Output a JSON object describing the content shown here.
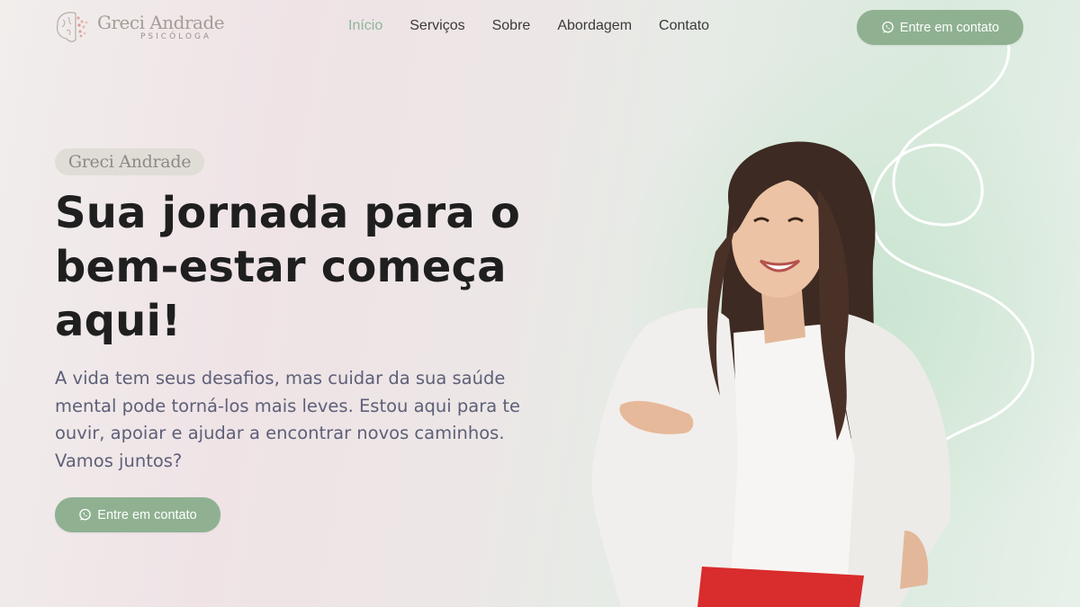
{
  "brand": {
    "name": "Greci Andrade",
    "subtitle": "PSICÓLOGA"
  },
  "nav": {
    "items": [
      {
        "label": "Início",
        "active": true
      },
      {
        "label": "Serviços",
        "active": false
      },
      {
        "label": "Sobre",
        "active": false
      },
      {
        "label": "Abordagem",
        "active": false
      },
      {
        "label": "Contato",
        "active": false
      }
    ]
  },
  "header_cta": {
    "label": "Entre em contato",
    "icon": "whatsapp-icon"
  },
  "hero": {
    "tag": "Greci Andrade",
    "headline_lines": [
      "Sua jornada para o",
      "bem-estar começa",
      "aqui!"
    ],
    "lead": "A vida tem seus desafios, mas cuidar da sua saúde mental pode torná-los mais leves. Estou aqui para te ouvir, apoiar e ajudar a encontrar novos caminhos. Vamos juntos?",
    "cta": {
      "label": "Entre em contato",
      "icon": "whatsapp-icon"
    }
  },
  "colors": {
    "accent": "#8fb191",
    "nav_active": "#8fb59b",
    "heading": "#1f1f1f",
    "body_text": "#5d6078"
  }
}
